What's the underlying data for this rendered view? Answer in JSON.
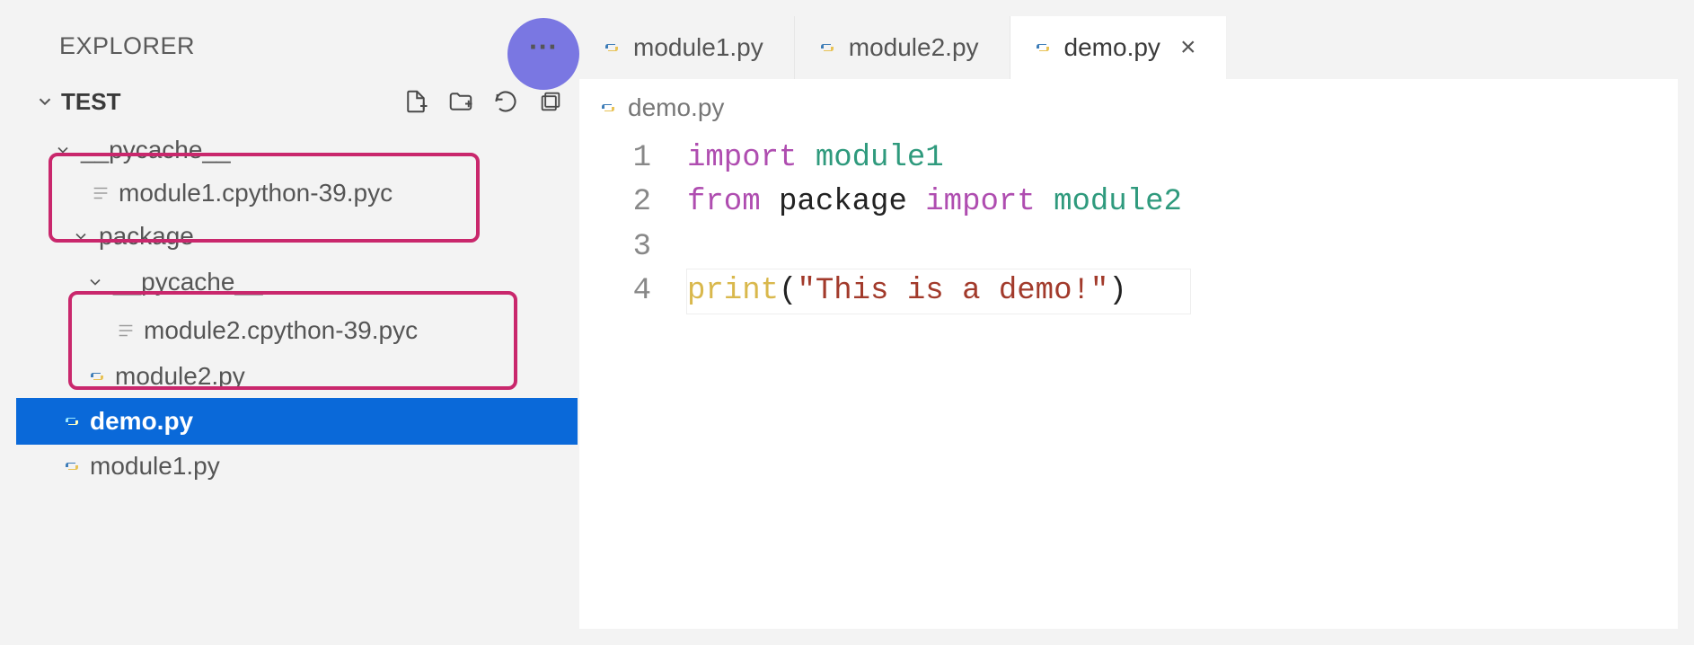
{
  "explorer": {
    "title": "EXPLORER",
    "root": "TEST",
    "actions": {
      "new_file": "new-file",
      "new_folder": "new-folder",
      "refresh": "refresh",
      "collapse": "collapse-all"
    },
    "tree": [
      {
        "type": "folder",
        "label": "__pycache__",
        "depth": 0,
        "open": true
      },
      {
        "type": "file",
        "label": "module1.cpython-39.pyc",
        "depth": 1,
        "icon": "text"
      },
      {
        "type": "folder",
        "label": "package",
        "depth": 0,
        "open": true
      },
      {
        "type": "folder",
        "label": "__pycache__",
        "depth": 1,
        "open": true
      },
      {
        "type": "file",
        "label": "module2.cpython-39.pyc",
        "depth": 2,
        "icon": "text"
      },
      {
        "type": "file",
        "label": "module2.py",
        "depth": 1,
        "icon": "python"
      },
      {
        "type": "file",
        "label": "demo.py",
        "depth": 0,
        "icon": "python",
        "selected": true
      },
      {
        "type": "file",
        "label": "module1.py",
        "depth": 0,
        "icon": "python"
      }
    ]
  },
  "tabs": [
    {
      "label": "module1.py",
      "active": false
    },
    {
      "label": "module2.py",
      "active": false
    },
    {
      "label": "demo.py",
      "active": true,
      "closeable": true
    }
  ],
  "breadcrumb": "demo.py",
  "code": {
    "lines": [
      {
        "n": "1",
        "tokens": [
          {
            "c": "kw",
            "t": "import"
          },
          {
            "c": "pl",
            "t": " "
          },
          {
            "c": "mod",
            "t": "module1"
          }
        ]
      },
      {
        "n": "2",
        "tokens": [
          {
            "c": "kw",
            "t": "from"
          },
          {
            "c": "pl",
            "t": " package "
          },
          {
            "c": "kw",
            "t": "import"
          },
          {
            "c": "pl",
            "t": " "
          },
          {
            "c": "mod",
            "t": "module2"
          }
        ]
      },
      {
        "n": "3",
        "tokens": []
      },
      {
        "n": "4",
        "current": true,
        "tokens": [
          {
            "c": "fn",
            "t": "print"
          },
          {
            "c": "pl",
            "t": "("
          },
          {
            "c": "str",
            "t": "\"This is a demo!\""
          },
          {
            "c": "pl",
            "t": ")"
          }
        ]
      }
    ]
  },
  "ellipsis": "···"
}
